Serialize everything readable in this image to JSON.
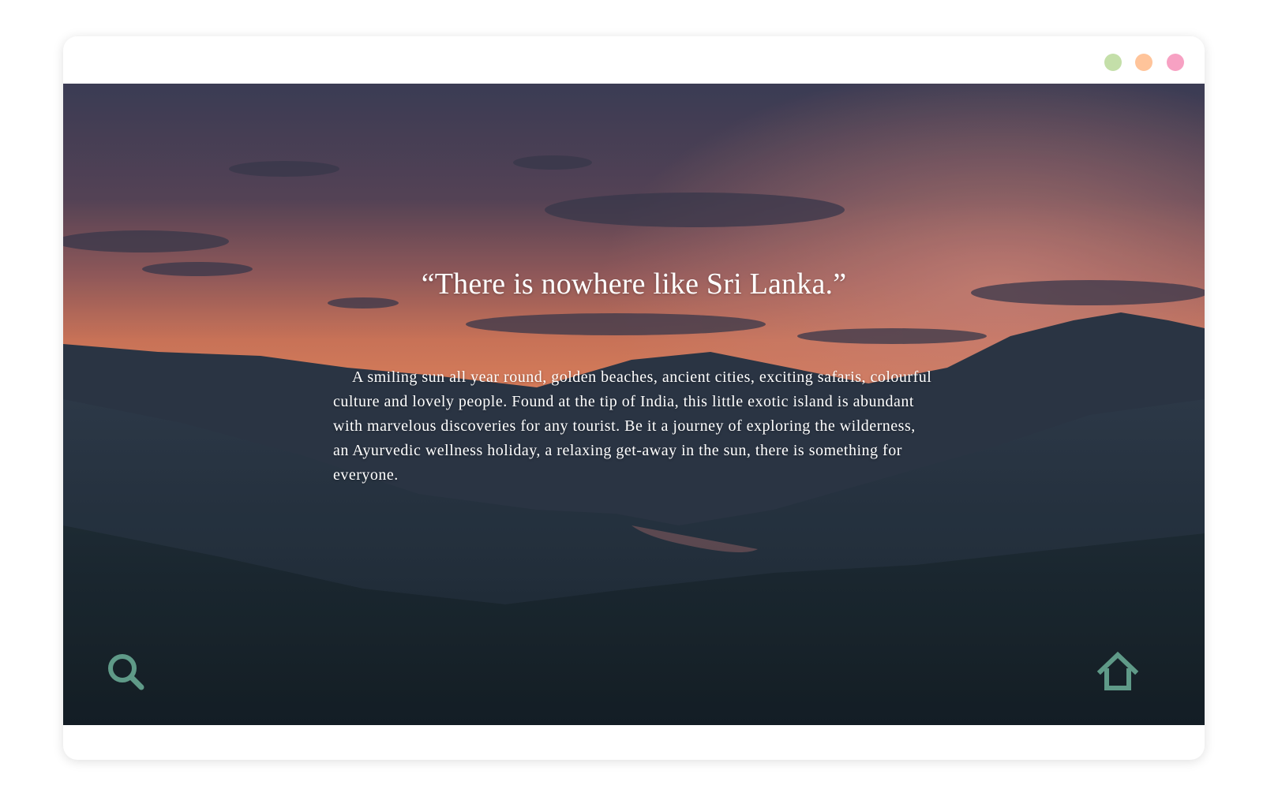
{
  "window": {
    "controls": [
      {
        "name": "green",
        "color": "#c4dfa9"
      },
      {
        "name": "orange",
        "color": "#ffc49a"
      },
      {
        "name": "pink",
        "color": "#f7a1c3"
      }
    ]
  },
  "hero": {
    "quote": "“There is nowhere like Sri Lanka.”",
    "description": "A smiling sun all year round, golden beaches, ancient cities, exciting safaris, colourful culture and lovely people. Found at the tip of India, this little exotic island is abundant with marvelous discoveries for any tourist. Be it a journey of exploring the wilderness, an Ayurvedic wellness holiday, a relaxing get-away in the sun, there is something for everyone."
  },
  "nav": {
    "search_icon": "search-icon",
    "home_icon": "home-icon",
    "icon_color": "#5f9a88"
  }
}
